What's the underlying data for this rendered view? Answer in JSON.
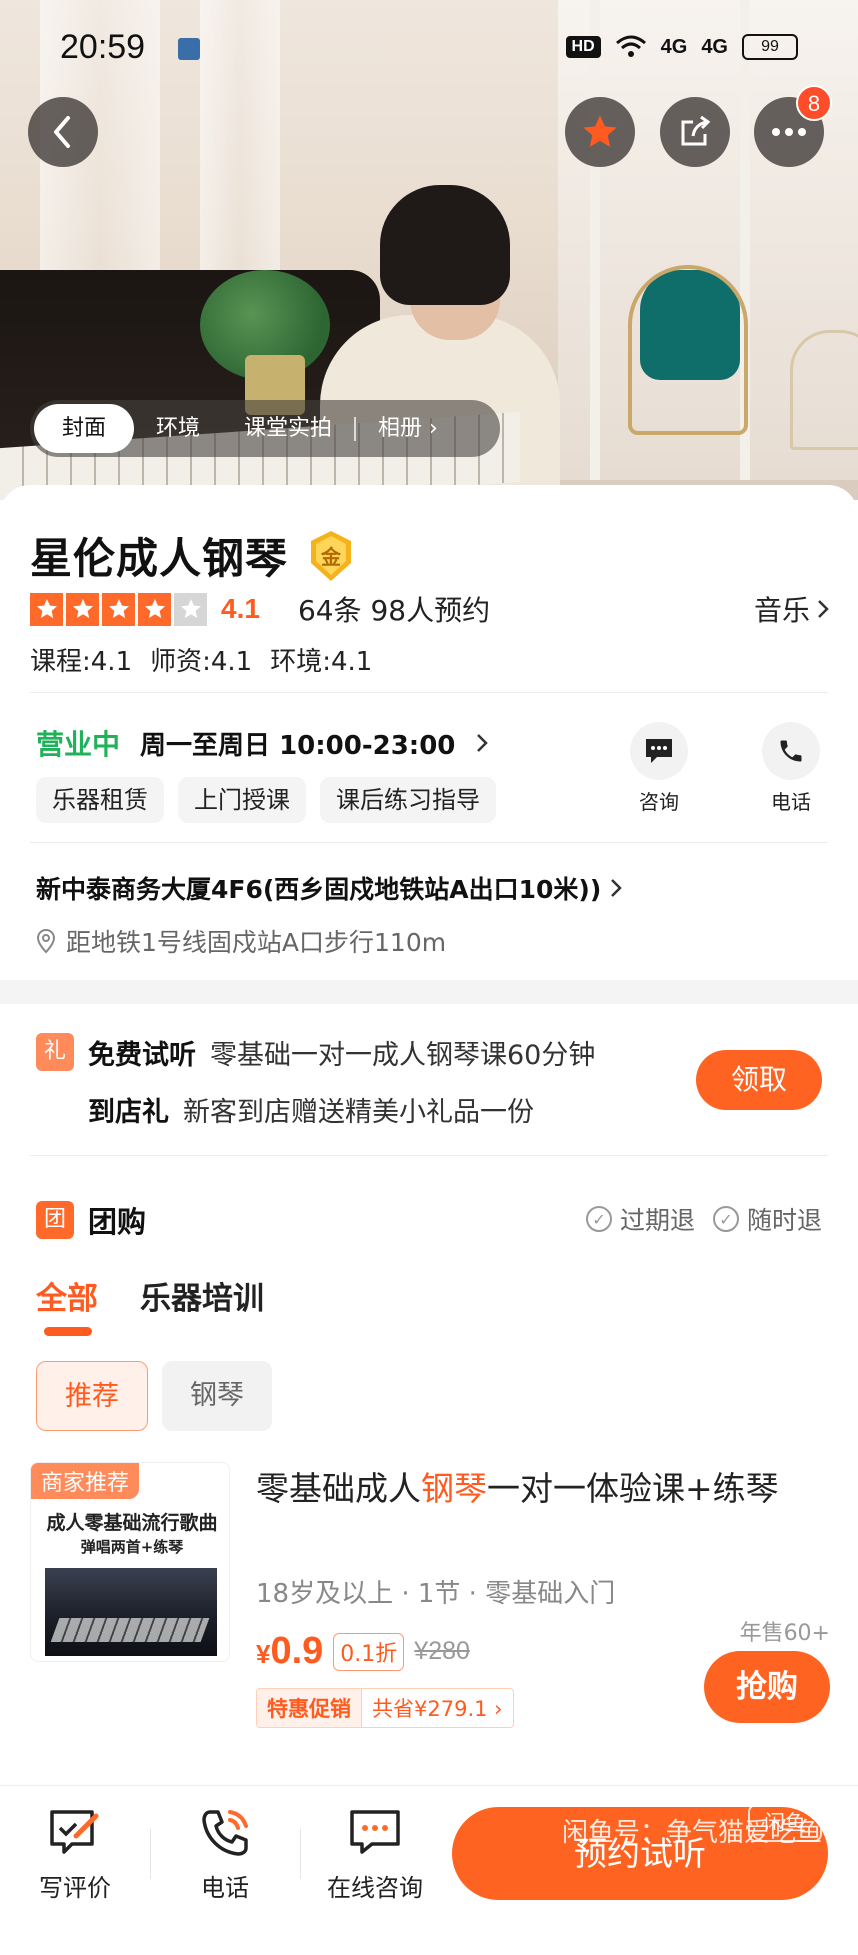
{
  "status_bar": {
    "time": "20:59",
    "network": "HD",
    "signal_a": "4G",
    "signal_b": "4G",
    "battery": "99"
  },
  "header": {
    "back_icon": "chevron-left-icon",
    "favorite_icon": "star-icon",
    "share_icon": "share-icon",
    "more_icon": "more-dots-icon",
    "more_badge": "8",
    "accent_color": "#ff6a2a"
  },
  "gallery_tabs": [
    {
      "label": "封面",
      "active": true
    },
    {
      "label": "环境",
      "active": false
    },
    {
      "label": "课堂实拍",
      "active": false
    },
    {
      "label": "相册 ›",
      "active": false
    }
  ],
  "shop": {
    "name": "星伦成人钢琴",
    "badge": "金",
    "rating": "4.1",
    "stars_filled": 4,
    "stars_total": 5,
    "review_count": "64条 98人预约",
    "category": "音乐",
    "scores": [
      "课程:4.1",
      "师资:4.1",
      "环境:4.1"
    ]
  },
  "hours": {
    "status": "营业中",
    "text": "周一至周日 10:00-23:00",
    "status_color": "#1fb25a"
  },
  "services": [
    "乐器租赁",
    "上门授课",
    "课后练习指导"
  ],
  "actions": {
    "consult_label": "咨询",
    "phone_label": "电话"
  },
  "address": {
    "main": "新中泰商务大厦4F6(西乡固戍地铁站A出口10米))",
    "distance": "距地铁1号线固戍站A口步行110m"
  },
  "promo": {
    "icon_text": "礼",
    "line1_key": "免费试听",
    "line1_value": "零基础一对一成人钢琴课60分钟",
    "line2_key": "到店礼",
    "line2_value": "新客到店赠送精美小礼品一份",
    "claim_label": "领取"
  },
  "group_buy": {
    "icon_text": "团",
    "title": "团购",
    "option1": "过期退",
    "option2": "随时退",
    "tabs": [
      "全部",
      "乐器培训"
    ],
    "chips": [
      "推荐",
      "钢琴"
    ]
  },
  "deal": {
    "image_tag": "商家推荐",
    "image_caption_line1": "成人零基础流行歌曲",
    "image_caption_line2": "弹唱两首+练琴",
    "title_prefix": "零基础成人",
    "title_highlight": "钢琴",
    "title_suffix": "一对一体验课+练琴",
    "meta": "18岁及以上 · 1节 · 零基础入门",
    "currency": "¥",
    "price": "0.9",
    "discount": "0.1折",
    "original_price": "¥280",
    "sold": "年售60+",
    "promo_label": "特惠促销",
    "promo_save": "共省¥279.1 ›",
    "buy_label": "抢购"
  },
  "bottom_bar": {
    "review_label": "写评价",
    "phone_label": "电话",
    "chat_label": "在线咨询",
    "reserve_label": "预约试听",
    "watermark": "闲鱼号：争气猫爱吃鱼",
    "watermark_logo": "闲鱼"
  }
}
